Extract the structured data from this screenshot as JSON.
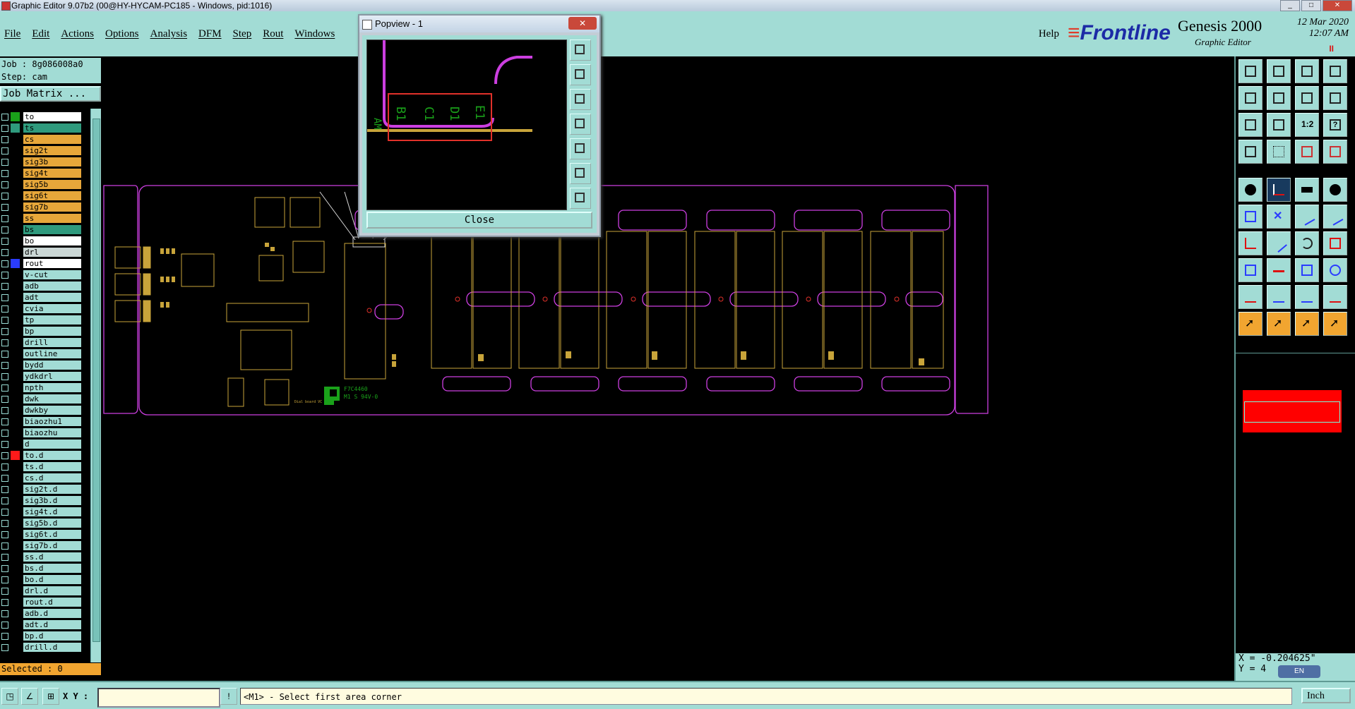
{
  "window": {
    "title": "Graphic Editor 9.07b2 (00@HY-HYCAM-PC185 - Windows, pid:1016)"
  },
  "menu": {
    "items": [
      "File",
      "Edit",
      "Actions",
      "Options",
      "Analysis",
      "DFM",
      "Step",
      "Rout",
      "Windows"
    ],
    "help": "Help"
  },
  "brand": {
    "logo": "Frontline",
    "product": "Genesis 2000",
    "subtitle": "Graphic Editor",
    "date": "12 Mar 2020",
    "time": "12:07 AM",
    "mark": "II"
  },
  "job": {
    "job_label": "Job : 8g086008a0",
    "step_label": "Step: cam",
    "matrix_button": "Job Matrix ..."
  },
  "layers": [
    {
      "name": "to",
      "color": "#1aa11a",
      "style": "white"
    },
    {
      "name": "ts",
      "color": "#2f9a7d",
      "style": "green"
    },
    {
      "name": "cs",
      "color": "",
      "style": "sel"
    },
    {
      "name": "sig2t",
      "color": "",
      "style": "sel"
    },
    {
      "name": "sig3b",
      "color": "",
      "style": "sel"
    },
    {
      "name": "sig4t",
      "color": "",
      "style": "sel"
    },
    {
      "name": "sig5b",
      "color": "",
      "style": "sel"
    },
    {
      "name": "sig6t",
      "color": "",
      "style": "sel"
    },
    {
      "name": "sig7b",
      "color": "",
      "style": "sel"
    },
    {
      "name": "ss",
      "color": "",
      "style": "sel"
    },
    {
      "name": "bs",
      "color": "",
      "style": "green"
    },
    {
      "name": "bo",
      "color": "",
      "style": "white"
    },
    {
      "name": "drl",
      "color": "",
      "style": "gray"
    },
    {
      "name": "rout",
      "color": "#2a3cff",
      "style": "white"
    },
    {
      "name": "v-cut",
      "color": "",
      "style": ""
    },
    {
      "name": "adb",
      "color": "",
      "style": ""
    },
    {
      "name": "adt",
      "color": "",
      "style": ""
    },
    {
      "name": "cvia",
      "color": "",
      "style": ""
    },
    {
      "name": "tp",
      "color": "",
      "style": ""
    },
    {
      "name": "bp",
      "color": "",
      "style": ""
    },
    {
      "name": "drill",
      "color": "",
      "style": ""
    },
    {
      "name": "outline",
      "color": "",
      "style": ""
    },
    {
      "name": "bydd",
      "color": "",
      "style": ""
    },
    {
      "name": "ydkdrl",
      "color": "",
      "style": ""
    },
    {
      "name": "npth",
      "color": "",
      "style": ""
    },
    {
      "name": "dwk",
      "color": "",
      "style": ""
    },
    {
      "name": "dwkby",
      "color": "",
      "style": ""
    },
    {
      "name": "biaozhu1",
      "color": "",
      "style": ""
    },
    {
      "name": "biaozhu",
      "color": "",
      "style": ""
    },
    {
      "name": "d",
      "color": "",
      "style": ""
    },
    {
      "name": "to.d",
      "color": "#ff1a1a",
      "style": ""
    },
    {
      "name": "ts.d",
      "color": "",
      "style": ""
    },
    {
      "name": "cs.d",
      "color": "",
      "style": ""
    },
    {
      "name": "sig2t.d",
      "color": "",
      "style": ""
    },
    {
      "name": "sig3b.d",
      "color": "",
      "style": ""
    },
    {
      "name": "sig4t.d",
      "color": "",
      "style": ""
    },
    {
      "name": "sig5b.d",
      "color": "",
      "style": ""
    },
    {
      "name": "sig6t.d",
      "color": "",
      "style": ""
    },
    {
      "name": "sig7b.d",
      "color": "",
      "style": ""
    },
    {
      "name": "ss.d",
      "color": "",
      "style": ""
    },
    {
      "name": "bs.d",
      "color": "",
      "style": ""
    },
    {
      "name": "bo.d",
      "color": "",
      "style": ""
    },
    {
      "name": "drl.d",
      "color": "",
      "style": ""
    },
    {
      "name": "rout.d",
      "color": "",
      "style": ""
    },
    {
      "name": "adb.d",
      "color": "",
      "style": ""
    },
    {
      "name": "adt.d",
      "color": "",
      "style": ""
    },
    {
      "name": "bp.d",
      "color": "",
      "style": ""
    },
    {
      "name": "drill.d",
      "color": "",
      "style": ""
    }
  ],
  "selected_label": "Selected : 0",
  "popview": {
    "title": "Popview - 1",
    "close_label": "Close",
    "labels": [
      "AM",
      "B1",
      "C1",
      "D1",
      "E1"
    ]
  },
  "board": {
    "silk_text1": "F7C4460",
    "silk_text2": "M1 S 94V-0",
    "silk_text3": "Dial board VC"
  },
  "coords": {
    "x_label": "X = -0.204625\"",
    "y_label": "Y = 4"
  },
  "status": {
    "xy_label": "X Y :",
    "xy_value": "",
    "message": "<M1> - Select first area corner",
    "unit": "Inch",
    "lang": "EN"
  },
  "colors": {
    "panel": "#a2dcd5",
    "accent": "#f1a530",
    "outline": "#cc3fe0",
    "copper": "#c8a43a"
  }
}
